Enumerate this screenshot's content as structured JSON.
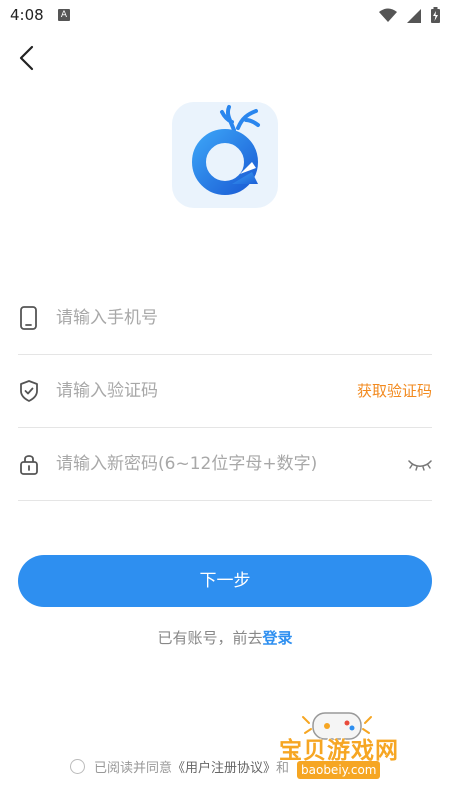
{
  "status_bar": {
    "time": "4:08",
    "notification_letter": "A"
  },
  "form": {
    "phone_placeholder": "请输入手机号",
    "code_placeholder": "请输入验证码",
    "get_code_label": "获取验证码",
    "password_placeholder": "请输入新密码(6~12位字母+数字)"
  },
  "next_button": {
    "label": "下一步"
  },
  "login_prompt": {
    "text": "已有账号，前去",
    "link_label": "登录"
  },
  "agreement": {
    "text": "已阅读并同意",
    "link_label": "《用户注册协议》",
    "and_text": "和"
  },
  "watermark": {
    "text": "宝贝游戏网",
    "url": "baobeiy.com"
  },
  "colors": {
    "accent": "#2e8ff0",
    "orange": "#f28a1f",
    "watermark": "#f6a623"
  },
  "icons": [
    "wifi-icon",
    "signal-icon",
    "battery-icon",
    "back-arrow-icon",
    "phone-icon",
    "shield-check-icon",
    "lock-icon",
    "eye-closed-icon"
  ]
}
